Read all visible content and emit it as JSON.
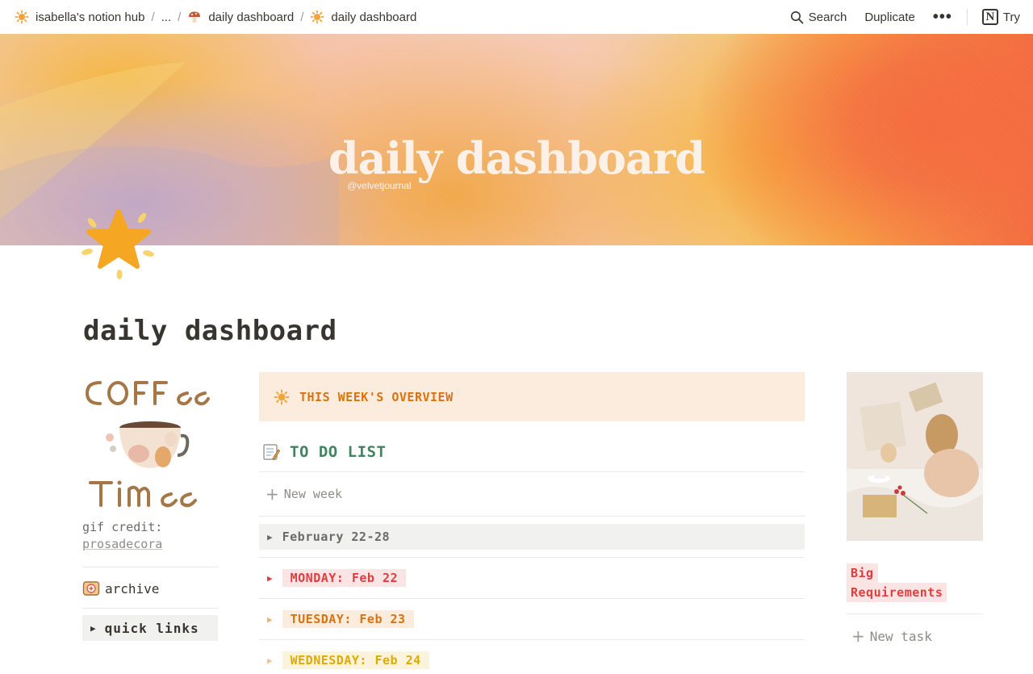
{
  "breadcrumb": {
    "items": [
      {
        "label": "isabella's notion hub",
        "icon": "sun-icon"
      },
      {
        "label": "..."
      },
      {
        "label": "daily dashboard",
        "icon": "mushroom-icon"
      },
      {
        "label": "daily dashboard",
        "icon": "sun-icon"
      }
    ],
    "separator": "/"
  },
  "topbar": {
    "search_label": "Search",
    "duplicate_label": "Duplicate",
    "more_label": "•••",
    "try_label": "Try"
  },
  "cover": {
    "title": "daily dashboard",
    "handle": "@velvetjournal"
  },
  "page": {
    "title": "daily dashboard",
    "icon": "star-icon"
  },
  "left": {
    "gif_credit_label": "gif credit:",
    "gif_credit_link": "prosadecora",
    "archive_label": "archive",
    "quick_links_label": "quick links"
  },
  "center": {
    "overview_label": "THIS WEEK'S OVERVIEW",
    "todo_label": "TO DO LIST",
    "new_week_label": "New week",
    "week_group_label": "February 22-28",
    "days": [
      {
        "label": "MONDAY: Feb 22"
      },
      {
        "label": "TUESDAY: Feb 23"
      },
      {
        "label": "WEDNESDAY: Feb 24"
      }
    ]
  },
  "right": {
    "tag_line1": "Big",
    "tag_line2": "Requirements",
    "new_task_label": "New task"
  },
  "colors": {
    "text": "#37352f",
    "orange": "#d9730d",
    "green": "#448361",
    "red": "#e03e3e",
    "yellow": "#dfab01"
  }
}
